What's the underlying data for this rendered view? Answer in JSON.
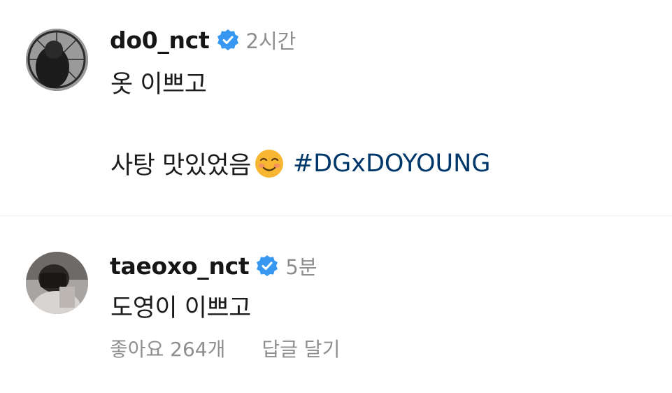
{
  "caption": {
    "username": "do0_nct",
    "time": "2시간",
    "line1": "옷 이쁘고",
    "line2": "사탕 맛있었음",
    "emoji": "smiling-face-icon",
    "hashtag": "#DGxDOYOUNG"
  },
  "comment": {
    "username": "taeoxo_nct",
    "time": "5분",
    "text": "도영이 이쁘고",
    "likes": "좋아요 264개",
    "reply": "답글 달기"
  },
  "colors": {
    "verified": "#3897f0",
    "hashtag": "#00376b",
    "muted": "#8e8e8e",
    "text": "#111111",
    "emoji": "#f7b733"
  },
  "icons": [
    "verified-badge-icon",
    "smiling-face-icon"
  ]
}
